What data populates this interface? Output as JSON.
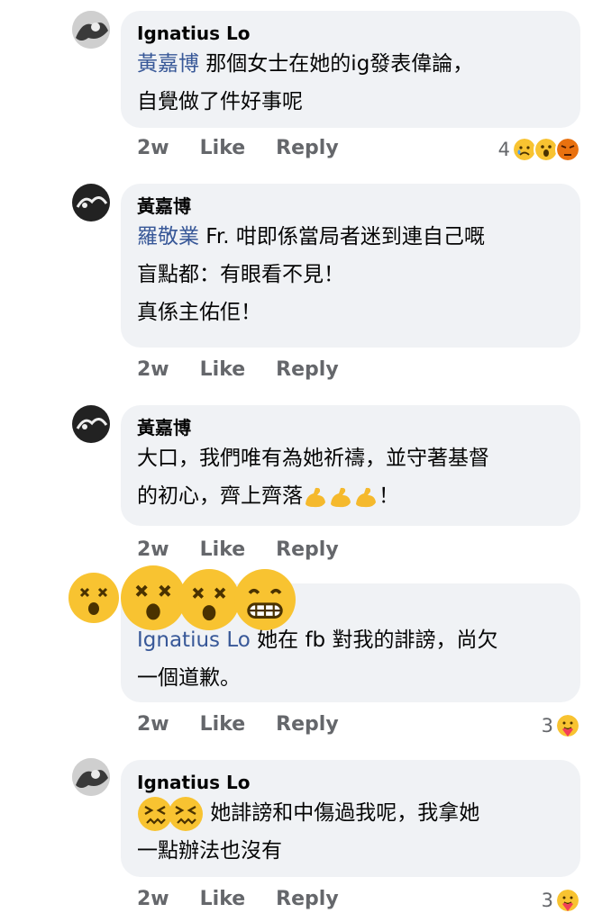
{
  "comments": [
    {
      "author": "Ignatius Lo",
      "mention": "黃嘉博",
      "line1": " 那個女士在她的ig發表偉論，",
      "line2": "自覺做了件好事呢",
      "time": "2w",
      "like": "Like",
      "reply": "Reply",
      "reaction_count": "4",
      "reactions": [
        "sad",
        "wow",
        "angry"
      ]
    },
    {
      "author": "黃嘉博",
      "mention": "羅敬業",
      "line1": " Fr. 咁即係當局者迷到連自己嘅",
      "line2": "盲點都：有眼看不見！",
      "line3": "真係主佑佢！",
      "time": "2w",
      "like": "Like",
      "reply": "Reply"
    },
    {
      "author": "黃嘉博",
      "line1": "大口，我們唯有為她祈禱，並守著基督",
      "line2a": "的初心，齊上齊落",
      "line2b": "！",
      "inline_emojis": [
        "flexed-biceps",
        "flexed-biceps",
        "flexed-biceps"
      ],
      "time": "2w",
      "like": "Like",
      "reply": "Reply"
    },
    {
      "mention": "Ignatius Lo",
      "line1": " 她在 fb 對我的誹謗，尚欠",
      "line2": "一個道歉。",
      "time": "2w",
      "like": "Like",
      "reply": "Reply",
      "reaction_count": "3",
      "reactions": [
        "care"
      ]
    },
    {
      "author": "Ignatius Lo",
      "line1": " 她誹謗和中傷過我呢，我拿她",
      "line2": "一點辦法也沒有",
      "inline_emojis": [
        "confounded-face",
        "confounded-face"
      ],
      "time": "2w",
      "like": "Like",
      "reply": "Reply",
      "reaction_count": "3",
      "reactions": [
        "care"
      ]
    }
  ],
  "overlay_emojis": [
    "dizzy-face",
    "dizzy-face",
    "dizzy-face",
    "grimacing-face"
  ],
  "colors": {
    "bubble": "#f0f2f5",
    "mention": "#385898",
    "meta": "#65676b",
    "emoji_yellow": "#f8c331"
  }
}
